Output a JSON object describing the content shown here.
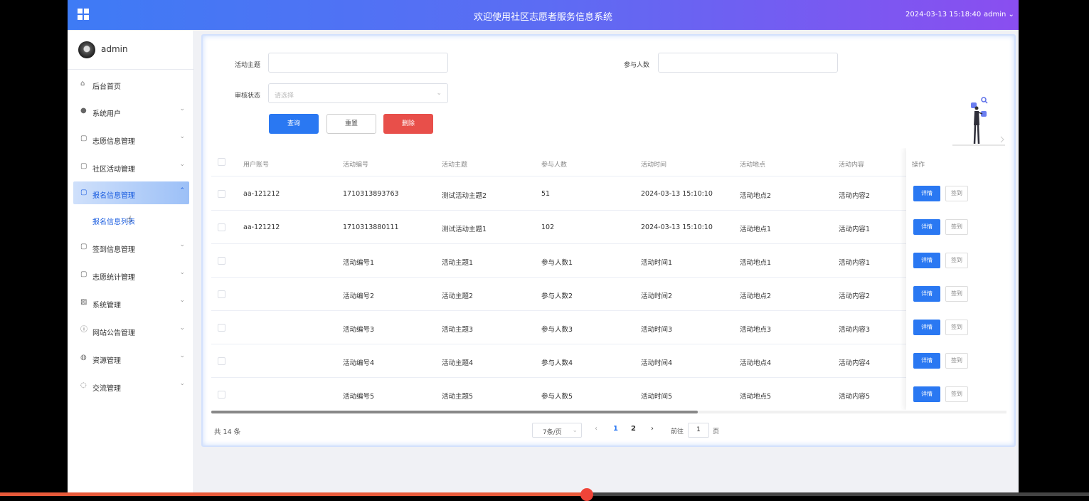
{
  "header": {
    "title": "欢迎使用社区志愿者服务信息系统",
    "datetime": "2024-03-13 15:18:40",
    "user": "admin"
  },
  "sidebar": {
    "username": "admin",
    "items": [
      {
        "label": "后台首页",
        "icon": "home-icon"
      },
      {
        "label": "系统用户",
        "icon": "user-icon"
      },
      {
        "label": "志愿信息管理",
        "icon": "doc-icon"
      },
      {
        "label": "社区活动管理",
        "icon": "doc-icon"
      },
      {
        "label": "报名信息管理",
        "icon": "doc-icon",
        "active": true
      },
      {
        "label": "签到信息管理",
        "icon": "doc-icon"
      },
      {
        "label": "志愿统计管理",
        "icon": "doc-icon"
      },
      {
        "label": "系统管理",
        "icon": "image-icon"
      },
      {
        "label": "网站公告管理",
        "icon": "info-icon"
      },
      {
        "label": "资源管理",
        "icon": "globe-icon"
      },
      {
        "label": "交流管理",
        "icon": "chat-icon"
      }
    ],
    "sub_item": "报名信息列表"
  },
  "search": {
    "topic_label": "活动主题",
    "topic_value": "",
    "people_label": "参与人数",
    "people_value": "",
    "status_label": "审核状态",
    "status_placeholder": "请选择",
    "query_button": "查询",
    "reset_button": "重置",
    "delete_button": "删除"
  },
  "table": {
    "columns": [
      "用户账号",
      "活动编号",
      "活动主题",
      "参与人数",
      "活动时间",
      "活动地点",
      "活动内容",
      "操作"
    ],
    "rows": [
      [
        "aa-121212",
        "1710313893763",
        "测试活动主题2",
        "51",
        "2024-03-13 15:10:10",
        "活动地点2",
        "活动内容2"
      ],
      [
        "aa-121212",
        "1710313880111",
        "测试活动主题1",
        "102",
        "2024-03-13 15:10:10",
        "活动地点1",
        "活动内容1"
      ],
      [
        "",
        "活动编号1",
        "活动主题1",
        "参与人数1",
        "活动时间1",
        "活动地点1",
        "活动内容1"
      ],
      [
        "",
        "活动编号2",
        "活动主题2",
        "参与人数2",
        "活动时间2",
        "活动地点2",
        "活动内容2"
      ],
      [
        "",
        "活动编号3",
        "活动主题3",
        "参与人数3",
        "活动时间3",
        "活动地点3",
        "活动内容3"
      ],
      [
        "",
        "活动编号4",
        "活动主题4",
        "参与人数4",
        "活动时间4",
        "活动地点4",
        "活动内容4"
      ],
      [
        "",
        "活动编号5",
        "活动主题5",
        "参与人数5",
        "活动时间5",
        "活动地点5",
        "活动内容5"
      ]
    ],
    "detail_button": "详情",
    "sign_button": "签到"
  },
  "pagination": {
    "total": "共 14 条",
    "page_size": "7条/页",
    "pages": [
      "1",
      "2"
    ],
    "current_page": "1",
    "goto_label": "前往",
    "goto_value": "1",
    "page_unit": "页"
  },
  "colors": {
    "primary": "#2a78f2",
    "danger": "#e84f4a",
    "header_start": "#3e7bf5",
    "header_end": "#8a4ef0"
  }
}
